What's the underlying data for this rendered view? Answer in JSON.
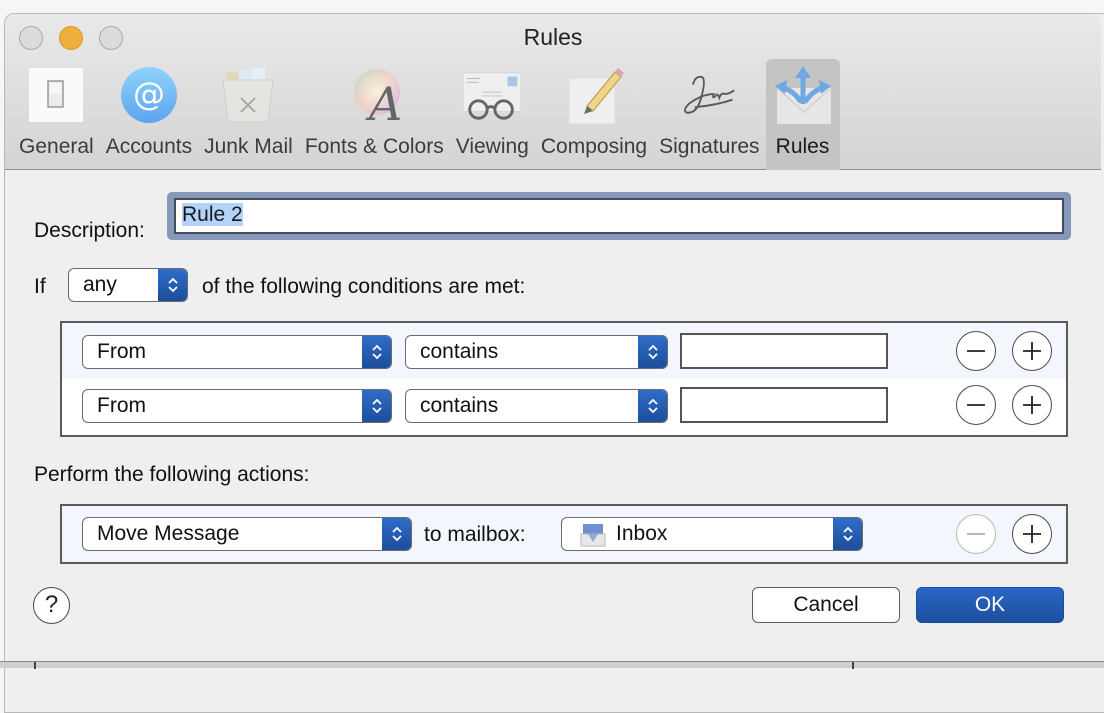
{
  "window": {
    "title": "Rules"
  },
  "toolbar": {
    "items": [
      {
        "label": "General",
        "icon": "general-switch-icon",
        "active": false
      },
      {
        "label": "Accounts",
        "icon": "at-sign-icon",
        "active": false
      },
      {
        "label": "Junk Mail",
        "icon": "junk-trash-icon",
        "active": false
      },
      {
        "label": "Fonts & Colors",
        "icon": "font-color-wheel-icon",
        "active": false
      },
      {
        "label": "Viewing",
        "icon": "glasses-envelope-icon",
        "active": false
      },
      {
        "label": "Composing",
        "icon": "pencil-paper-icon",
        "active": false
      },
      {
        "label": "Signatures",
        "icon": "signature-icon",
        "active": false
      },
      {
        "label": "Rules",
        "icon": "rules-envelope-arrows-icon",
        "active": true
      }
    ]
  },
  "form": {
    "description_label": "Description:",
    "description_value": "Rule 2",
    "if_label": "If",
    "match_select": "any",
    "conditions_suffix": "of the following conditions are met:",
    "conditions": [
      {
        "field": "From",
        "operator": "contains",
        "value": ""
      },
      {
        "field": "From",
        "operator": "contains",
        "value": ""
      }
    ],
    "actions_label": "Perform the following actions:",
    "actions": [
      {
        "action": "Move Message",
        "target_label": "to mailbox:",
        "mailbox": "Inbox",
        "remove_enabled": false
      }
    ]
  },
  "buttons": {
    "help": "?",
    "cancel": "Cancel",
    "ok": "OK"
  },
  "colors": {
    "accent": "#1d4f9d",
    "selection": "#b4d3fa",
    "focus_ring": "#8598b8",
    "minimize": "#eeb03a"
  }
}
